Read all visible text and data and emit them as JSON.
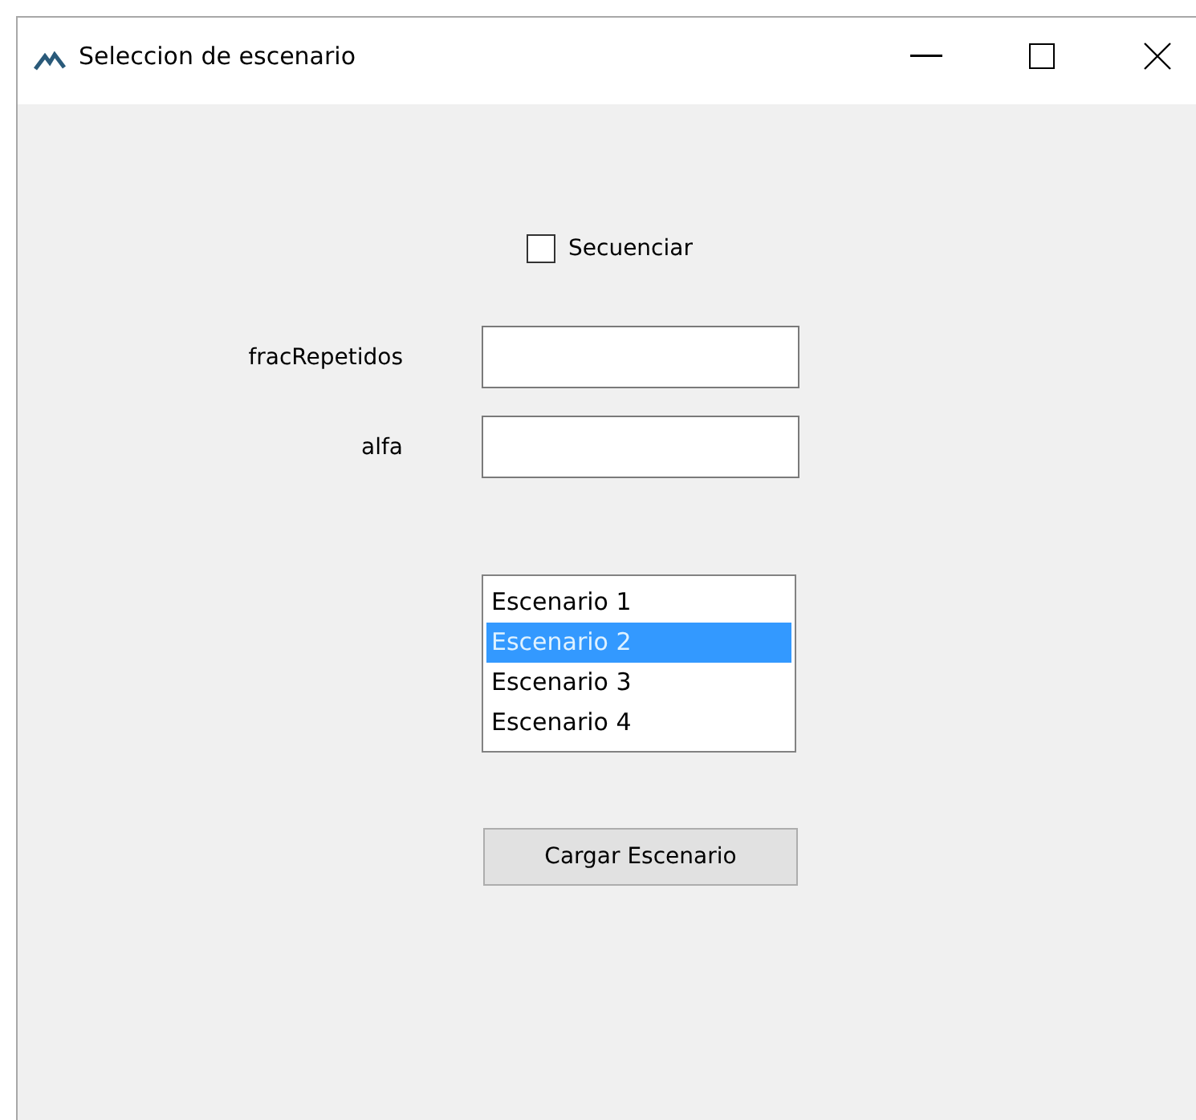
{
  "window": {
    "title": "Seleccion de escenario"
  },
  "checkbox": {
    "label": "Secuenciar",
    "checked": false
  },
  "fields": [
    {
      "label": "fracRepetidos"
    },
    {
      "label": "alfa"
    }
  ],
  "scenario_list": [
    {
      "label": "Escenario 1",
      "selected": false
    },
    {
      "label": "Escenario 2",
      "selected": true
    },
    {
      "label": "Escenario 3",
      "selected": false
    },
    {
      "label": "Escenario 4",
      "selected": false
    }
  ],
  "button": {
    "label": "Cargar Escenario"
  }
}
